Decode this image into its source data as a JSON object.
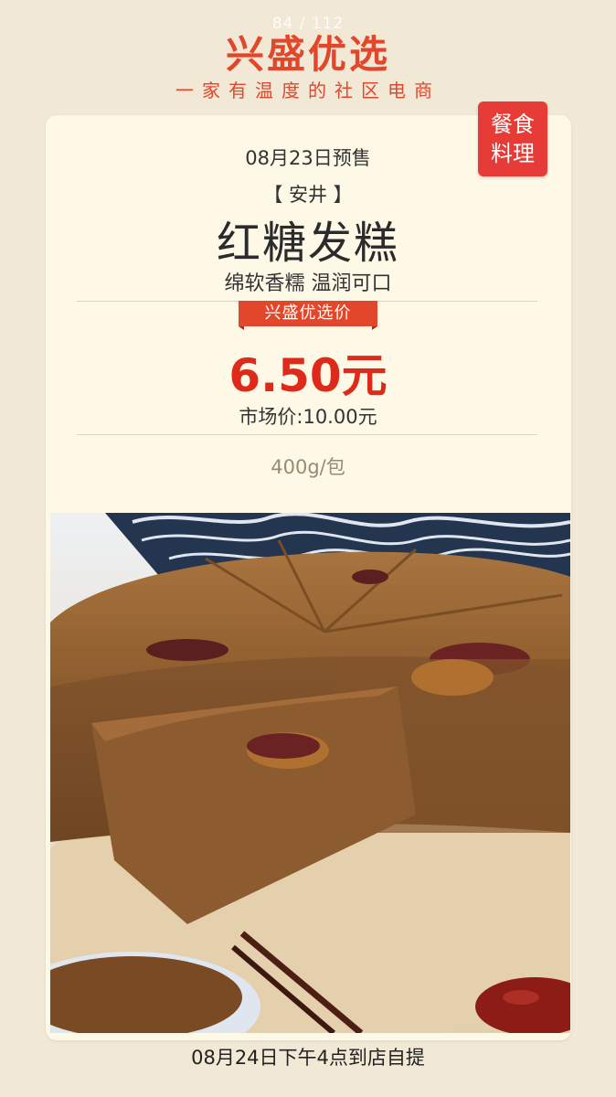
{
  "header": {
    "page_counter": "84 / 112",
    "brand_title": "兴盛优选",
    "slogan": "一家有温度的社区电商"
  },
  "product": {
    "category_badge_line1": "餐食",
    "category_badge_line2": "料理",
    "presale_date": "08月23日预售",
    "origin": "【 安井 】",
    "name": "红糖发糕",
    "tagline": "绵软香糯 温润可口",
    "price_tag": "兴盛优选价",
    "sale_price": "6.50元",
    "market_price": "市场价:10.00元",
    "weight": "400g/包"
  },
  "footer": {
    "pickup": "08月24日下午4点到店自提"
  },
  "colors": {
    "background": "#f1e8d6",
    "card": "#fdf9e6",
    "brand_red": "#e2462b",
    "price_red": "#dd2a1b"
  }
}
